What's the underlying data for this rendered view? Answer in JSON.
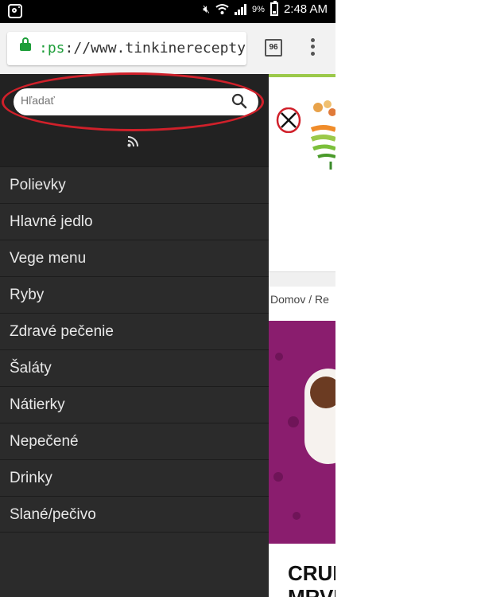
{
  "status_bar": {
    "battery_percent": "9%",
    "time": "2:48 AM",
    "icons": [
      "instagram-icon",
      "mute-icon",
      "wifi-icon",
      "signal-icon",
      "battery-icon"
    ]
  },
  "browser": {
    "url_scheme_fragment": ":ps",
    "url_rest": "://www.tinkinerecepty.sk/c",
    "tab_count": "96"
  },
  "drawer": {
    "search_placeholder": "Hľadať",
    "menu_items": [
      "Polievky",
      "Hlavné jedlo",
      "Vege menu",
      "Ryby",
      "Zdravé pečenie",
      "Šaláty",
      "Nátierky",
      "Nepečené",
      "Drinky",
      "Slané/pečivo"
    ]
  },
  "page": {
    "breadcrumb": "Domov / Re",
    "post_title_line1": "CRUMI",
    "post_title_line2": "MRVE"
  },
  "colors": {
    "drawer_bg": "#2b2b2b",
    "drawer_top_bg": "#222222",
    "annotation_red": "#d0202a",
    "lock_green": "#1e9e3a",
    "accent_green": "#9bc94a",
    "hero_purple": "#8a1d6e"
  }
}
